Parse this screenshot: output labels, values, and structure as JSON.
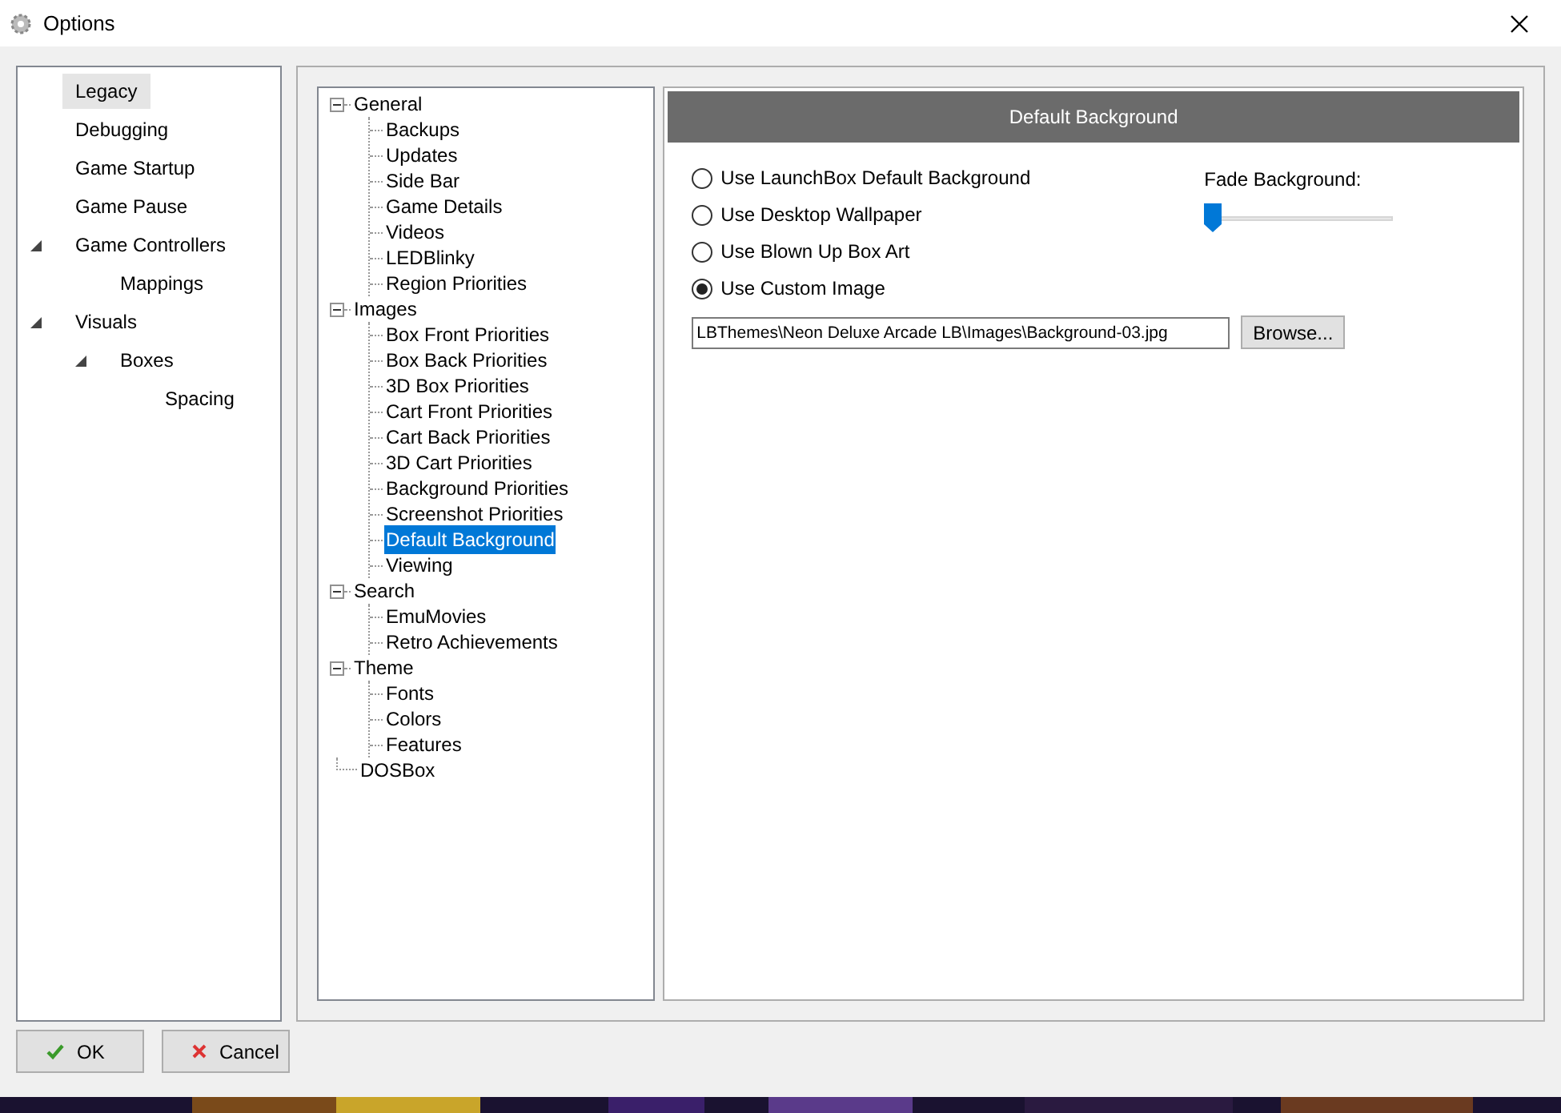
{
  "window": {
    "title": "Options"
  },
  "nav": [
    {
      "label": "Legacy",
      "selected": true,
      "expanded": false
    },
    {
      "label": "Debugging",
      "selected": false,
      "expanded": false
    },
    {
      "label": "Game Startup",
      "selected": false,
      "expanded": false
    },
    {
      "label": "Game Pause",
      "selected": false,
      "expanded": false
    },
    {
      "label": "Game Controllers",
      "selected": false,
      "expanded": true,
      "children": [
        {
          "label": "Mappings",
          "selected": false,
          "expanded": false
        }
      ]
    },
    {
      "label": "Visuals",
      "selected": false,
      "expanded": true,
      "children": [
        {
          "label": "Boxes",
          "selected": false,
          "expanded": true,
          "children": [
            {
              "label": "Spacing",
              "selected": false,
              "expanded": false
            }
          ]
        }
      ]
    }
  ],
  "tree": [
    {
      "label": "General",
      "selected": false,
      "expanded": true,
      "children": [
        {
          "label": "Backups",
          "selected": false
        },
        {
          "label": "Updates",
          "selected": false
        },
        {
          "label": "Side Bar",
          "selected": false
        },
        {
          "label": "Game Details",
          "selected": false
        },
        {
          "label": "Videos",
          "selected": false
        },
        {
          "label": "LEDBlinky",
          "selected": false
        },
        {
          "label": "Region Priorities",
          "selected": false
        }
      ]
    },
    {
      "label": "Images",
      "selected": false,
      "expanded": true,
      "children": [
        {
          "label": "Box Front Priorities",
          "selected": false
        },
        {
          "label": "Box Back Priorities",
          "selected": false
        },
        {
          "label": "3D Box Priorities",
          "selected": false
        },
        {
          "label": "Cart Front Priorities",
          "selected": false
        },
        {
          "label": "Cart Back Priorities",
          "selected": false
        },
        {
          "label": "3D Cart Priorities",
          "selected": false
        },
        {
          "label": "Background Priorities",
          "selected": false
        },
        {
          "label": "Screenshot Priorities",
          "selected": false
        },
        {
          "label": "Default Background",
          "selected": true
        },
        {
          "label": "Viewing",
          "selected": false
        }
      ]
    },
    {
      "label": "Search",
      "selected": false,
      "expanded": true,
      "children": [
        {
          "label": "EmuMovies",
          "selected": false
        },
        {
          "label": "Retro Achievements",
          "selected": false
        }
      ]
    },
    {
      "label": "Theme",
      "selected": false,
      "expanded": true,
      "children": [
        {
          "label": "Fonts",
          "selected": false
        },
        {
          "label": "Colors",
          "selected": false
        },
        {
          "label": "Features",
          "selected": false
        }
      ]
    },
    {
      "label": "DOSBox",
      "selected": false,
      "expanded": false
    }
  ],
  "panel": {
    "header": "Default Background",
    "options": [
      {
        "label": "Use LaunchBox Default Background",
        "selected": false
      },
      {
        "label": "Use Desktop Wallpaper",
        "selected": false
      },
      {
        "label": "Use Blown Up Box Art",
        "selected": false
      },
      {
        "label": "Use Custom Image",
        "selected": true
      }
    ],
    "fade": {
      "label": "Fade Background:",
      "level": 0
    },
    "path_field": {
      "value": "LBThemes\\Neon Deluxe Arcade LB\\Images\\Background-03.jpg"
    },
    "browse_button": "Browse..."
  },
  "buttons": [
    {
      "label": "OK",
      "kind": "ok"
    },
    {
      "label": "Cancel",
      "kind": "cancel"
    }
  ]
}
